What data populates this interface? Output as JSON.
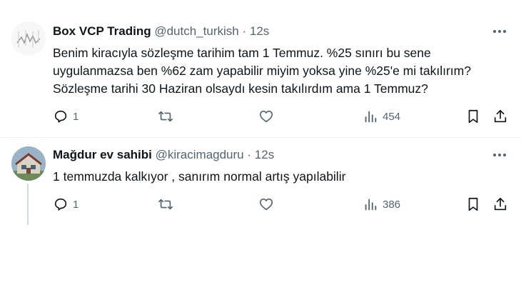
{
  "tweets": [
    {
      "display_name": "Box VCP Trading",
      "handle": "@dutch_turkish",
      "separator": "·",
      "time": "12s",
      "text": "Benim kiracıyla sözleşme tarihim tam 1 Temmuz. %25 sınırı bu sene uygulanmazsa ben %62 zam yapabilir miyim yoksa yine %25'e mi takılırım? Sözleşme tarihi 30 Haziran olsaydı kesin takılırdım ama 1 Temmuz?",
      "replies": "1",
      "views": "454"
    },
    {
      "display_name": "Mağdur ev sahibi",
      "handle": "@kiracimagduru",
      "separator": "·",
      "time": "12s",
      "text": "1 temmuzda kalkıyor , sanırım normal artış yapılabilir",
      "replies": "1",
      "views": "386"
    }
  ],
  "colors": {
    "text_primary": "#0f1419",
    "text_secondary": "#536471",
    "thread_line": "#cfd9de",
    "divider": "#eff3f4"
  },
  "icons": [
    "more-icon",
    "reply-icon",
    "retweet-icon",
    "like-icon",
    "views-icon",
    "bookmark-icon",
    "share-icon"
  ]
}
